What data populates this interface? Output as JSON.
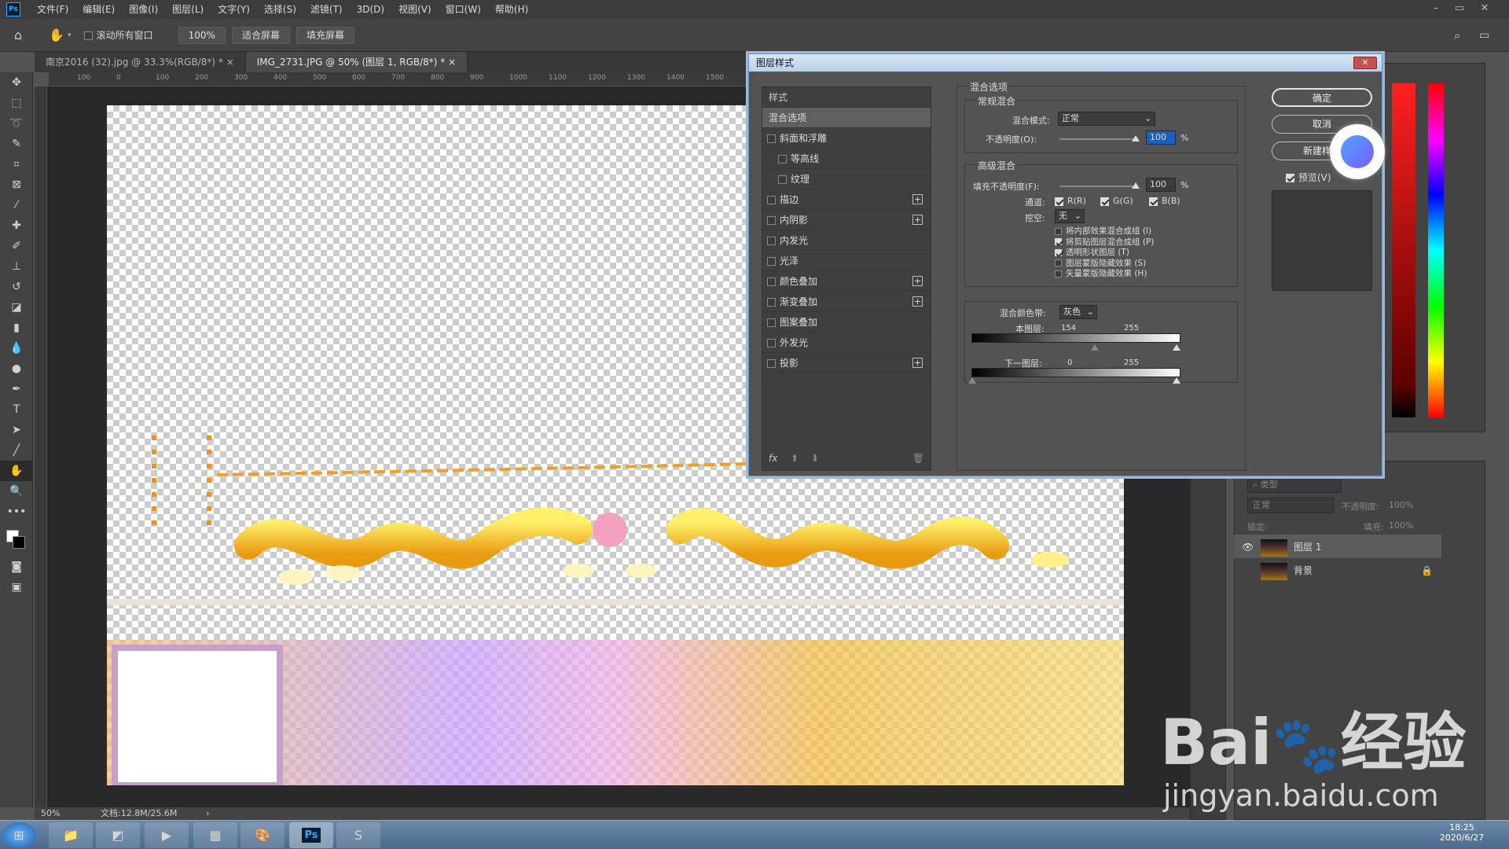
{
  "menubar": {
    "logo": "Ps",
    "items": [
      "文件(F)",
      "编辑(E)",
      "图像(I)",
      "图层(L)",
      "文字(Y)",
      "选择(S)",
      "滤镜(T)",
      "3D(D)",
      "视图(V)",
      "窗口(W)",
      "帮助(H)"
    ],
    "win_min": "–",
    "win_max": "▭",
    "win_close": "✕"
  },
  "options": {
    "scroll_all": "滚动所有窗口",
    "zoom": "100%",
    "fit_screen": "适合屏幕",
    "fill_screen": "填充屏幕"
  },
  "tabs": [
    {
      "label": "南京2016 (32).jpg @ 33.3%(RGB/8*) *",
      "close": "×"
    },
    {
      "label": "IMG_2731.JPG @ 50% (图层 1, RGB/8*) *",
      "close": "×"
    }
  ],
  "ruler_ticks": [
    "100",
    "0",
    "100",
    "200",
    "300",
    "400",
    "500",
    "600",
    "700",
    "800",
    "900",
    "1000",
    "1100",
    "1200",
    "1300",
    "1400",
    "1500"
  ],
  "status": {
    "zoom": "50%",
    "doc": "文档:12.8M/25.6M",
    "arrow": "›"
  },
  "dialog": {
    "title": "图层样式",
    "close": "✕",
    "styles_header": "样式",
    "styles": [
      {
        "label": "混合选项",
        "selected": true
      },
      {
        "label": "斜面和浮雕",
        "check": true
      },
      {
        "label": "等高线",
        "check": true,
        "indent": true
      },
      {
        "label": "纹理",
        "check": true,
        "indent": true
      },
      {
        "label": "描边",
        "check": true,
        "plus": "+"
      },
      {
        "label": "内阴影",
        "check": true,
        "plus": "+"
      },
      {
        "label": "内发光",
        "check": true
      },
      {
        "label": "光泽",
        "check": true
      },
      {
        "label": "颜色叠加",
        "check": true,
        "plus": "+"
      },
      {
        "label": "渐变叠加",
        "check": true,
        "plus": "+"
      },
      {
        "label": "图案叠加",
        "check": true
      },
      {
        "label": "外发光",
        "check": true
      },
      {
        "label": "投影",
        "check": true,
        "plus": "+"
      }
    ],
    "fx": "fx",
    "blend_options": "混合选项",
    "general_blend": "常规混合",
    "blend_mode_label": "混合模式:",
    "blend_mode_value": "正常",
    "opacity_label": "不透明度(O):",
    "opacity_value": "100",
    "percent": "%",
    "advanced_blend": "高级混合",
    "fill_opacity_label": "填充不透明度(F):",
    "fill_opacity_value": "100",
    "channels_label": "通道:",
    "ch_r": "R(R)",
    "ch_g": "G(G)",
    "ch_b": "B(B)",
    "knockout_label": "挖空:",
    "knockout_value": "无",
    "options": [
      "将内部效果混合成组 (I)",
      "将剪贴图层混合成组 (P)",
      "透明形状图层 (T)",
      "图层蒙版隐藏效果 (S)",
      "矢量蒙版隐藏效果 (H)"
    ],
    "options_checked": [
      false,
      true,
      true,
      false,
      false
    ],
    "blend_if_label": "混合颜色带:",
    "blend_if_value": "灰色",
    "this_layer_label": "本图层:",
    "this_layer_lo": "154",
    "this_layer_hi": "255",
    "under_layer_label": "下一图层:",
    "under_layer_lo": "0",
    "under_layer_hi": "255",
    "ok": "确定",
    "cancel": "取消",
    "new_style": "新建样式",
    "preview": "预览(V)"
  },
  "layers": {
    "blend": "正常",
    "opacity_label": "不透明度:",
    "opacity": "100%",
    "lock_label": "锁定:",
    "fill_label": "填充:",
    "fill": "100%",
    "search": "类型",
    "items": [
      {
        "name": "图层 1",
        "visible": true,
        "selected": true
      },
      {
        "name": "背景",
        "visible": false,
        "selected": false
      }
    ]
  },
  "taskbar": {
    "time": "18:25",
    "date": "2020/6/27",
    "apps": [
      "Explorer",
      "Kingsoft",
      "Video",
      "Calculator",
      "Paint",
      "Ps",
      "Sogou"
    ]
  },
  "watermark": {
    "brand": "Bai",
    "brand_tail": "经验",
    "url": "jingyan.baidu.com"
  }
}
